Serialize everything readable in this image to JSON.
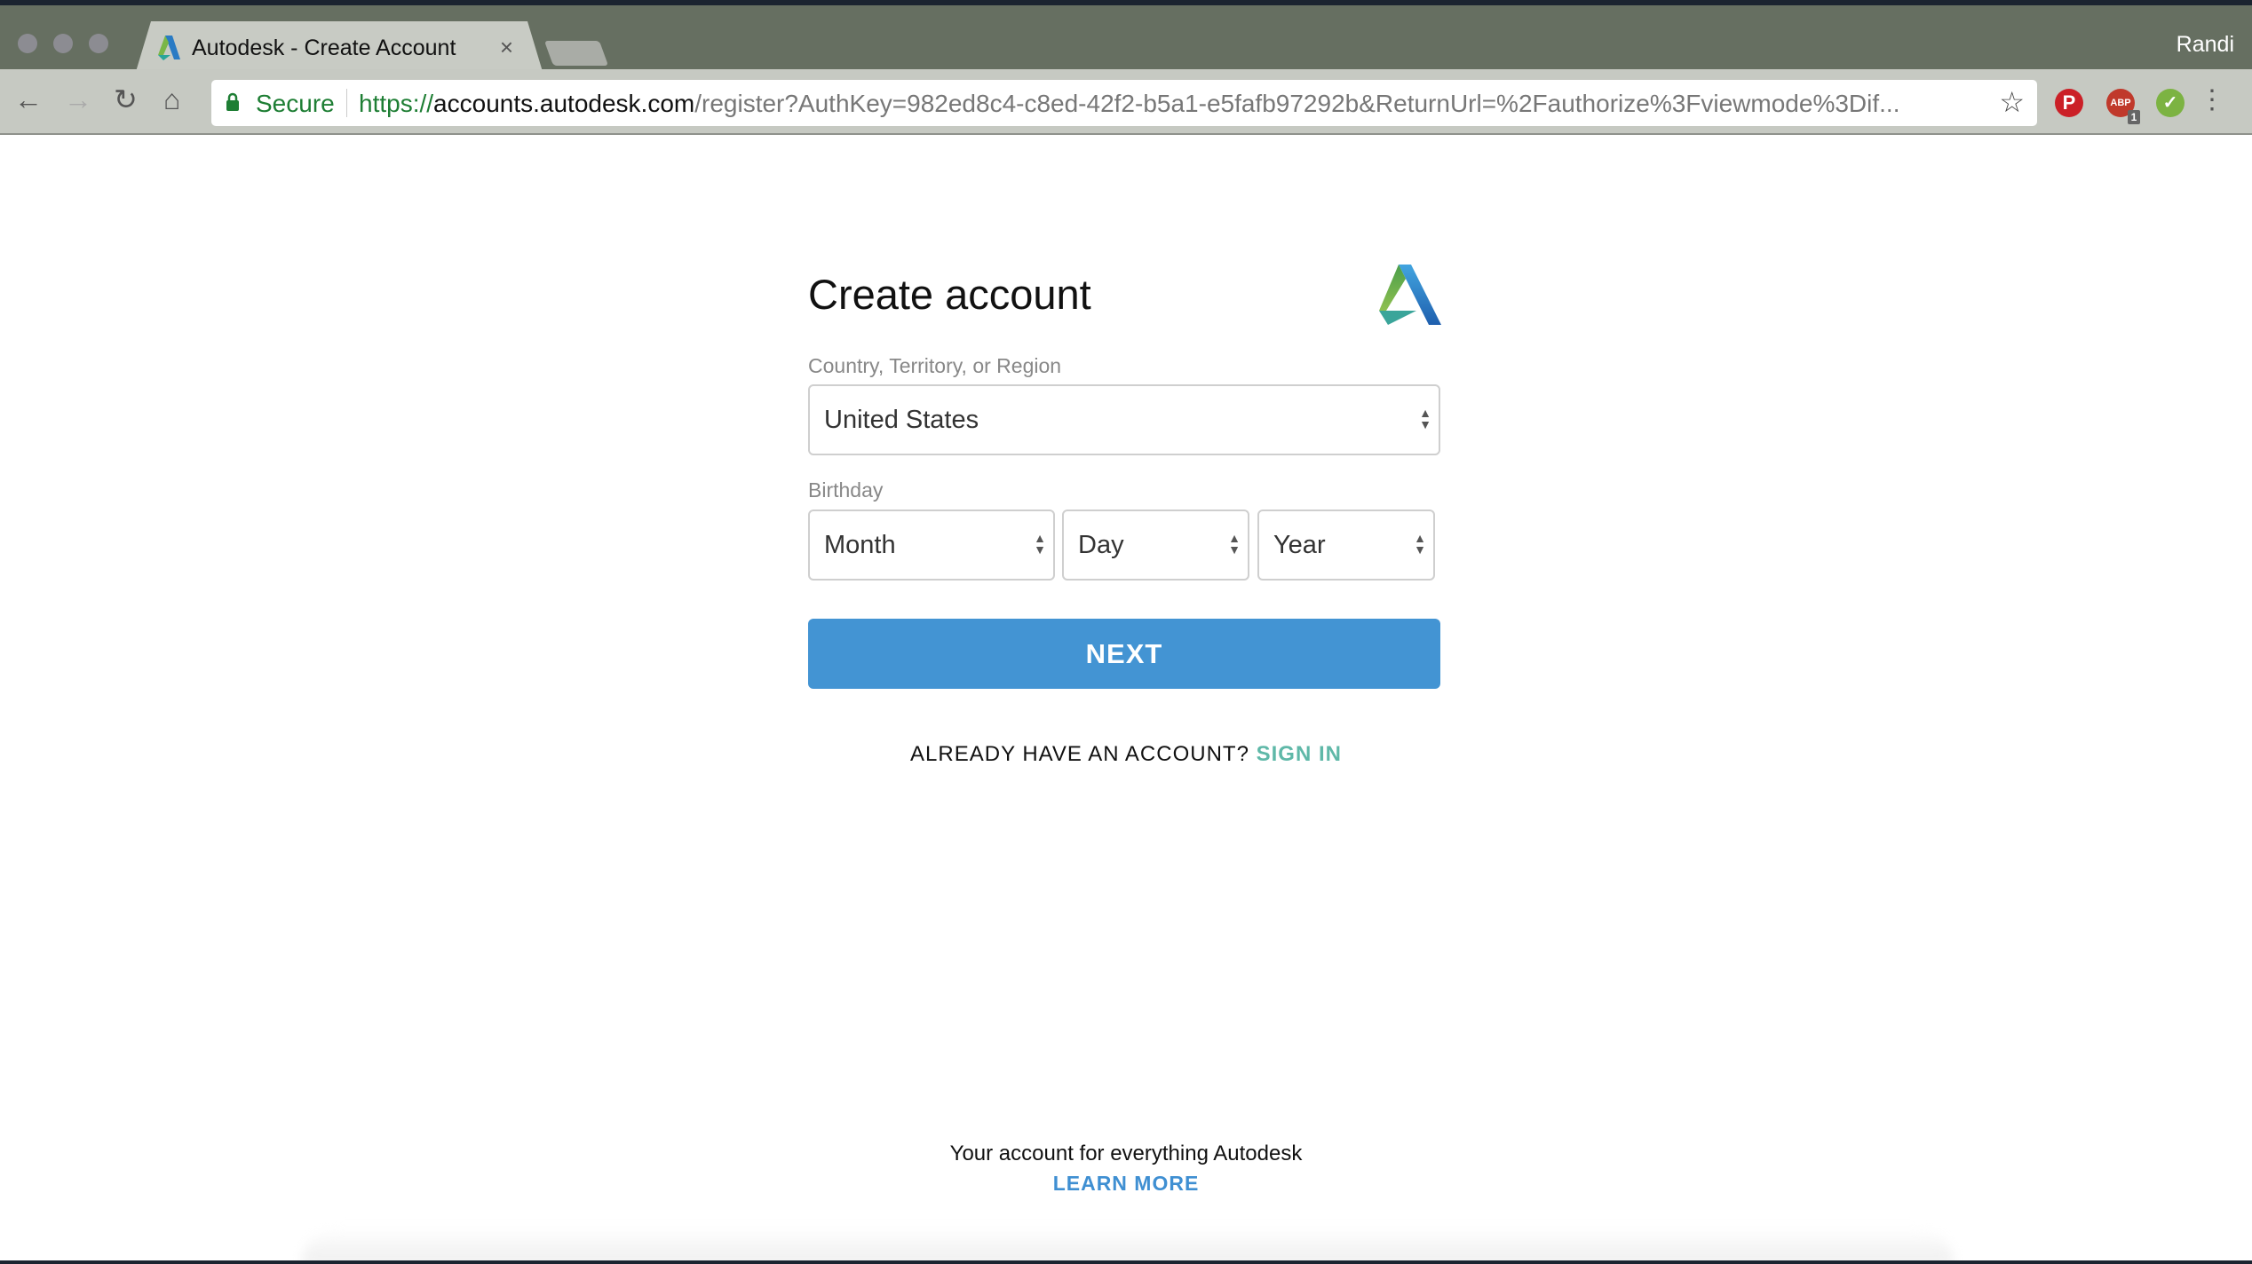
{
  "browser": {
    "tab_title": "Autodesk - Create Account",
    "tab_close": "×",
    "profile_name": "Randi",
    "secure_label": "Secure",
    "url_scheme": "https://",
    "url_domain": "accounts.autodesk.com",
    "url_path": "/register?AuthKey=982ed8c4-c8ed-42f2-b5a1-e5fafb97292b&ReturnUrl=%2Fauthorize%3Fviewmode%3Dif...",
    "extensions": [
      {
        "name": "pinterest",
        "label": "P",
        "color": "#cb2027"
      },
      {
        "name": "adblock",
        "label": "ABP",
        "badge": "1",
        "color": "#c0392b"
      },
      {
        "name": "check",
        "label": "✓",
        "color": "#7cb342"
      }
    ]
  },
  "form": {
    "title": "Create account",
    "country_label": "Country, Territory, or Region",
    "country_value": "United States",
    "birthday_label": "Birthday",
    "month_value": "Month",
    "day_value": "Day",
    "year_value": "Year",
    "next_label": "NEXT",
    "already_text": "ALREADY HAVE AN ACCOUNT?",
    "sign_in_label": "SIGN IN"
  },
  "footer": {
    "text": "Your account for everything Autodesk",
    "learn_more": "LEARN MORE"
  },
  "colors": {
    "primary": "#4394d3",
    "sign_in": "#5fb8a8",
    "tabbar": "#666f61"
  }
}
